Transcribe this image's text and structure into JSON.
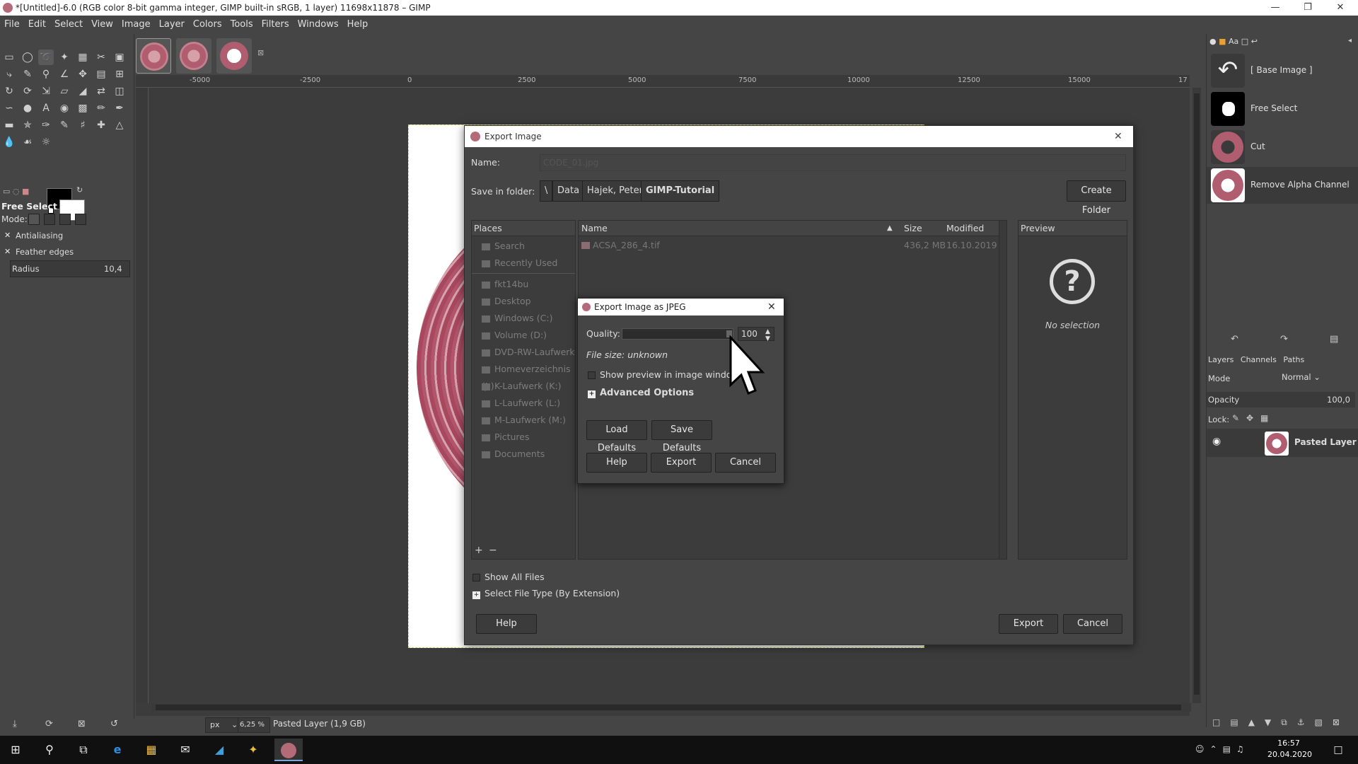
{
  "window": {
    "title": "*[Untitled]-6.0 (RGB color 8-bit gamma integer, GIMP built-in sRGB, 1 layer) 11698x11878 – GIMP"
  },
  "menu": [
    "File",
    "Edit",
    "Select",
    "View",
    "Image",
    "Layer",
    "Colors",
    "Tools",
    "Filters",
    "Windows",
    "Help"
  ],
  "ruler_ticks": [
    "-5000",
    "-2500",
    "0",
    "2500",
    "5000",
    "7500",
    "10000",
    "12500",
    "15000",
    "17"
  ],
  "tool_options": {
    "title": "Free Select",
    "mode_label": "Mode:",
    "antialiasing": "Antialiasing",
    "feather_edges": "Feather edges",
    "radius_label": "Radius",
    "radius_value": "10,4"
  },
  "statusbar": {
    "unit": "px",
    "zoom": "6,25 %",
    "layer_info": "Pasted Layer (1,9 GB)"
  },
  "undo_history": [
    {
      "label": "[ Base Image ]",
      "icon": "undo-icon"
    },
    {
      "label": "Free Select",
      "icon": "free-select-icon"
    },
    {
      "label": "Cut",
      "icon": "cut-icon"
    },
    {
      "label": "Remove Alpha Channel",
      "icon": "remove-alpha-icon"
    }
  ],
  "layers_panel": {
    "tabs": [
      "Layers",
      "Channels",
      "Paths"
    ],
    "mode_label": "Mode",
    "mode_value": "Normal",
    "opacity_label": "Opacity",
    "opacity_value": "100,0",
    "lock_label": "Lock:",
    "layer_name": "Pasted Layer"
  },
  "export_dialog": {
    "title": "Export Image",
    "name_label": "Name:",
    "name_value": "CODE_01.jpg",
    "folder_label": "Save in folder:",
    "path": [
      "\\",
      "Data",
      "Hajek, Peter",
      "GIMP-Tutorial"
    ],
    "create_folder": "Create Folder",
    "places_header": "Places",
    "places": [
      "Search",
      "Recently Used",
      "fkt14bu",
      "Desktop",
      "Windows (C:)",
      "Volume (D:)",
      "DVD-RW-Laufwerk ...",
      "Homeverzeichnis (J:)",
      "K-Laufwerk (K:)",
      "L-Laufwerk (L:)",
      "M-Laufwerk (M:)",
      "Pictures",
      "Documents"
    ],
    "columns": {
      "name": "Name",
      "size": "Size",
      "modified": "Modified"
    },
    "files": [
      {
        "name": "ACSA_286_4.tif",
        "size": "436,2 MB",
        "modified": "16.10.2019"
      }
    ],
    "preview_header": "Preview",
    "preview_text": "No selection",
    "show_all_files": "Show All Files",
    "select_file_type": "Select File Type (By Extension)",
    "help": "Help",
    "export": "Export",
    "cancel": "Cancel"
  },
  "jpeg_dialog": {
    "title": "Export Image as JPEG",
    "quality_label": "Quality:",
    "quality_value": "100",
    "file_size": "File size: unknown",
    "show_preview": "Show preview in image window",
    "advanced": "Advanced Options",
    "load_defaults": "Load Defaults",
    "save_defaults": "Save Defaults",
    "help": "Help",
    "export": "Export",
    "cancel": "Cancel"
  },
  "taskbar": {
    "time": "16:57",
    "date": "20.04.2020"
  }
}
